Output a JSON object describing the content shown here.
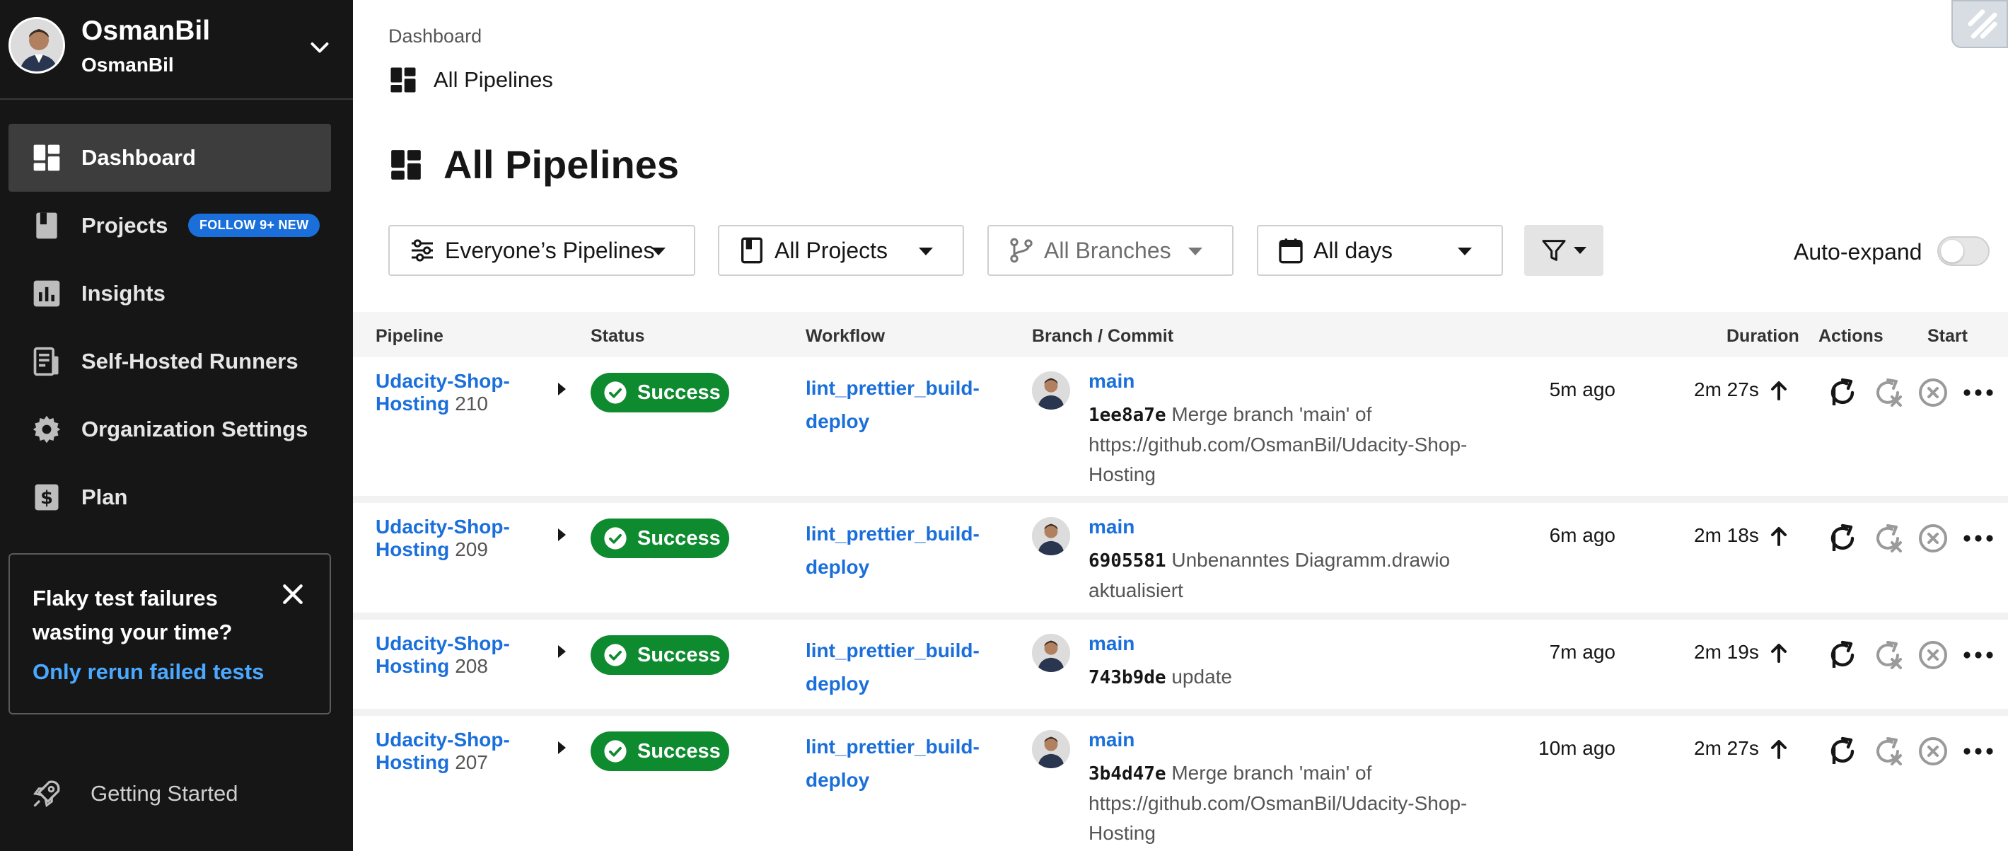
{
  "org": {
    "name": "OsmanBil",
    "sub": "OsmanBil"
  },
  "nav": [
    {
      "label": "Dashboard",
      "icon": "dashboard-icon",
      "active": true
    },
    {
      "label": "Projects",
      "icon": "projects-icon",
      "badge": "FOLLOW 9+ NEW"
    },
    {
      "label": "Insights",
      "icon": "insights-icon"
    },
    {
      "label": "Self-Hosted Runners",
      "icon": "runners-icon"
    },
    {
      "label": "Organization Settings",
      "icon": "gear-icon"
    },
    {
      "label": "Plan",
      "icon": "plan-icon"
    }
  ],
  "promo": {
    "title": "Flaky test failures wasting your time?",
    "link": "Only rerun failed tests"
  },
  "getting_started": "Getting Started",
  "breadcrumb": {
    "parent": "Dashboard",
    "current": "All Pipelines"
  },
  "page_title": "All Pipelines",
  "filters": {
    "pipelines": "Everyone’s Pipelines",
    "projects": "All Projects",
    "branches": "All Branches",
    "days": "All days",
    "auto_expand": "Auto-expand"
  },
  "table": {
    "headers": [
      "Pipeline",
      "Status",
      "Workflow",
      "Branch / Commit",
      "Start",
      "Duration",
      "Actions"
    ],
    "rows": [
      {
        "pipeline": "Udacity-Shop-Hosting",
        "number": "210",
        "status": "Success",
        "workflow": "lint_prettier_build-deploy",
        "branch": "main",
        "sha": "1ee8a7e",
        "message": "Merge branch 'main' of https://github.com/OsmanBil/Udacity-Shop-Hosting",
        "start": "5m ago",
        "duration": "2m 27s"
      },
      {
        "pipeline": "Udacity-Shop-Hosting",
        "number": "209",
        "status": "Success",
        "workflow": "lint_prettier_build-deploy",
        "branch": "main",
        "sha": "6905581",
        "message": "Unbenanntes Diagramm.drawio aktualisiert",
        "start": "6m ago",
        "duration": "2m 18s"
      },
      {
        "pipeline": "Udacity-Shop-Hosting",
        "number": "208",
        "status": "Success",
        "workflow": "lint_prettier_build-deploy",
        "branch": "main",
        "sha": "743b9de",
        "message": "update",
        "start": "7m ago",
        "duration": "2m 19s"
      },
      {
        "pipeline": "Udacity-Shop-Hosting",
        "number": "207",
        "status": "Success",
        "workflow": "lint_prettier_build-deploy",
        "branch": "main",
        "sha": "3b4d47e",
        "message": "Merge branch 'main' of https://github.com/OsmanBil/Udacity-Shop-Hosting",
        "start": "10m ago",
        "duration": "2m 27s"
      }
    ]
  },
  "colors": {
    "sidebar": "#161616",
    "link": "#1a6fdb",
    "success": "#0e8a2f",
    "badge": "#1a6fdb"
  }
}
